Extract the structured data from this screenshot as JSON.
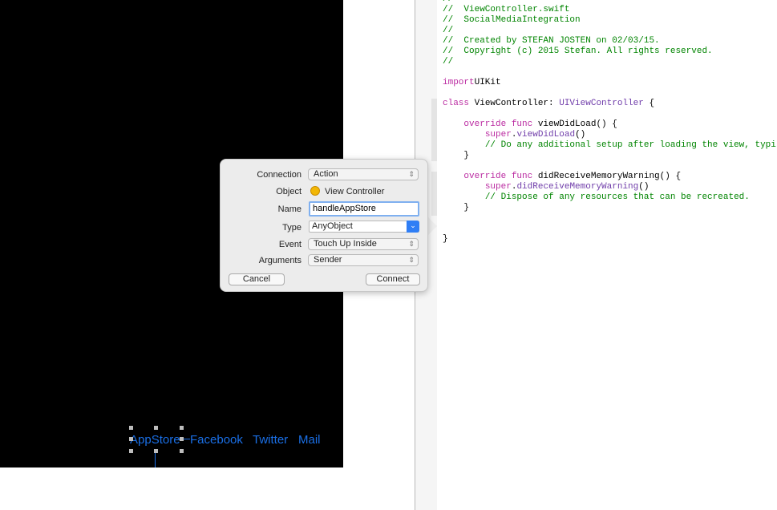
{
  "canvas": {
    "buttons": [
      "AppStore",
      "Facebook",
      "Twitter",
      "Mail"
    ],
    "accent": "#1a6fe6"
  },
  "editor": {
    "lines": [
      [
        [
          "c",
          "//"
        ]
      ],
      [
        [
          "c",
          "//  ViewController.swift"
        ]
      ],
      [
        [
          "c",
          "//  SocialMediaIntegration"
        ]
      ],
      [
        [
          "c",
          "//"
        ]
      ],
      [
        [
          "c",
          "//  Created by STEFAN JOSTEN on 02/03/15."
        ]
      ],
      [
        [
          "c",
          "//  Copyright (c) 2015 Stefan. All rights reserved."
        ]
      ],
      [
        [
          "c",
          "//"
        ]
      ],
      [],
      [
        [
          "k",
          "import"
        ],
        [
          "",
          "UIKit"
        ]
      ],
      [],
      [
        [
          "k",
          "class"
        ],
        [
          "",
          " ViewController: "
        ],
        [
          "t",
          "UIViewController"
        ],
        [
          "",
          " {"
        ]
      ],
      [],
      [
        [
          "",
          "    "
        ],
        [
          "k",
          "override func"
        ],
        [
          "",
          " viewDidLoad() {"
        ]
      ],
      [
        [
          "",
          "        "
        ],
        [
          "k",
          "super"
        ],
        [
          "",
          "."
        ],
        [
          "t",
          "viewDidLoad"
        ],
        [
          "",
          "()"
        ]
      ],
      [
        [
          "",
          "        "
        ],
        [
          "c",
          "// Do any additional setup after loading the view, typi"
        ]
      ],
      [
        [
          "",
          "    }"
        ]
      ],
      [],
      [
        [
          "",
          "    "
        ],
        [
          "k",
          "override func"
        ],
        [
          "",
          " didReceiveMemoryWarning() {"
        ]
      ],
      [
        [
          "",
          "        "
        ],
        [
          "k",
          "super"
        ],
        [
          "",
          "."
        ],
        [
          "t",
          "didReceiveMemoryWarning"
        ],
        [
          "",
          "()"
        ]
      ],
      [
        [
          "",
          "        "
        ],
        [
          "c",
          "// Dispose of any resources that can be recreated."
        ]
      ],
      [
        [
          "",
          "    }"
        ]
      ],
      [],
      [],
      [
        [
          "",
          "}"
        ]
      ]
    ]
  },
  "popup": {
    "connection_label": "Connection",
    "connection_value": "Action",
    "object_label": "Object",
    "object_value": "View Controller",
    "object_icon": "view-controller-icon",
    "name_label": "Name",
    "name_value": "handleAppStore",
    "type_label": "Type",
    "type_value": "AnyObject",
    "event_label": "Event",
    "event_value": "Touch Up Inside",
    "arguments_label": "Arguments",
    "arguments_value": "Sender",
    "cancel": "Cancel",
    "connect": "Connect"
  }
}
